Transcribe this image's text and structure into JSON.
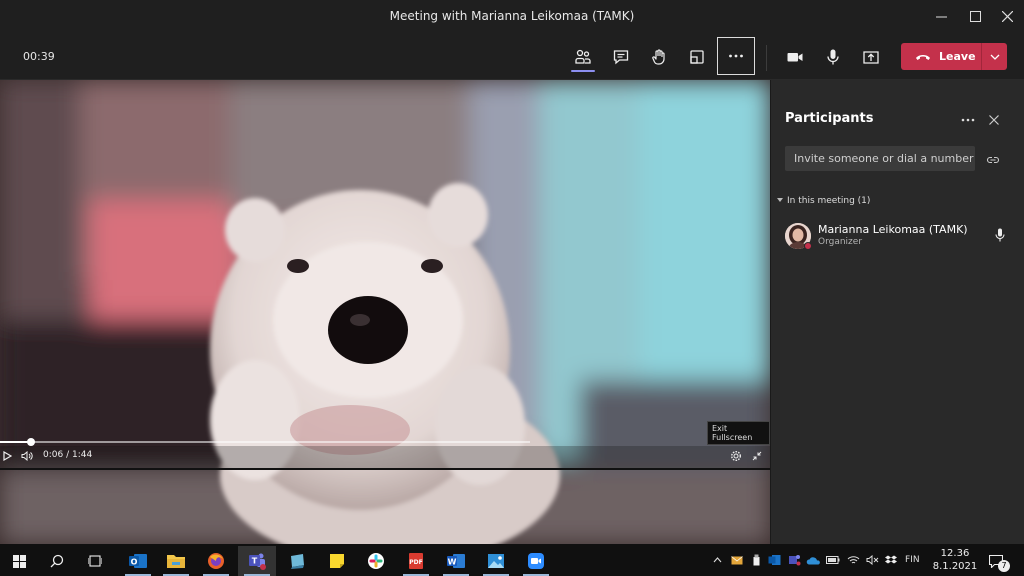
{
  "window": {
    "title": "Meeting with Marianna Leikomaa (TAMK)",
    "minimize_icon": "minimize-icon",
    "maximize_icon": "maximize-icon",
    "close_icon": "close-icon"
  },
  "toolbar": {
    "timer": "00:39",
    "buttons": [
      "people-icon",
      "chat-icon",
      "raise-hand-icon",
      "breakout-rooms-icon",
      "more-actions-icon",
      "camera-icon",
      "microphone-icon",
      "share-screen-icon"
    ],
    "leave_label": "Leave",
    "leave_color": "#c4314b"
  },
  "video": {
    "current_time": "0:06",
    "separator": "/",
    "duration": "1:44",
    "progress_fraction": 0.058,
    "tooltip": "Exit Fullscreen"
  },
  "participants": {
    "title": "Participants",
    "invite_placeholder": "Invite someone or dial a number",
    "section_label": "In this meeting (1)",
    "people": [
      {
        "name": "Marianna Leikomaa (TAMK)",
        "role": "Organizer"
      }
    ]
  },
  "taskbar": {
    "apps": [
      "start-icon",
      "search-icon",
      "task-view-icon",
      "outlook-icon",
      "file-explorer-icon",
      "firefox-icon",
      "teams-icon",
      "notes-icon",
      "sticky-notes-icon",
      "slack-icon",
      "pdf-icon",
      "word-icon",
      "photos-icon",
      "zoom-icon"
    ],
    "language": "FIN",
    "time": "12.36",
    "date": "8.1.2021",
    "notification_count": "7"
  }
}
